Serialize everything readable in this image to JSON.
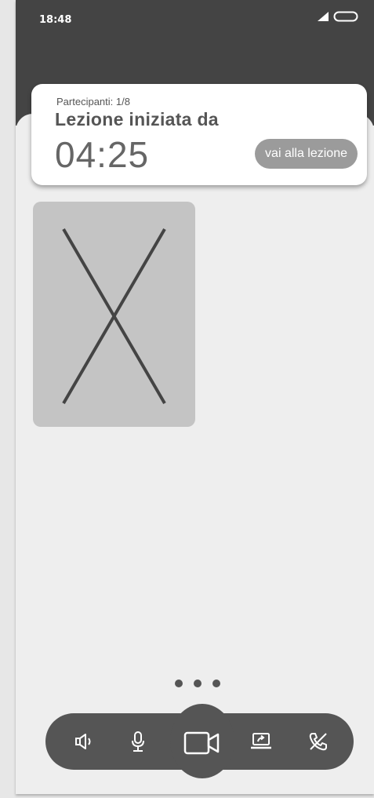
{
  "status_bar": {
    "time": "18:48"
  },
  "lesson_card": {
    "participants": "Partecipanti: 1/8",
    "title": "Lezione iniziata da",
    "timer": "04:25",
    "join_label": "vai alla lezione"
  },
  "controls": {
    "buttons": [
      "speaker-icon",
      "microphone-icon",
      "video-camera-icon",
      "screen-share-icon",
      "end-call-icon"
    ]
  },
  "colors": {
    "dark": "#444444",
    "controls": "#555555",
    "tile": "#c4c4c4",
    "button": "#9b9b9b"
  }
}
